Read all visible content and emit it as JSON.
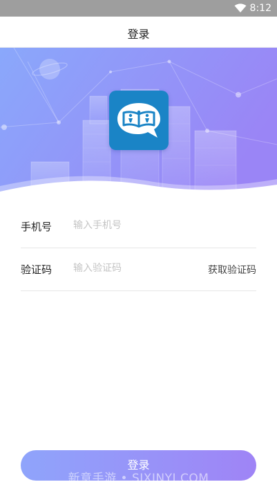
{
  "status_bar": {
    "time": "8:12",
    "wifi_icon": "wifi-icon"
  },
  "header": {
    "title": "登录"
  },
  "hero": {
    "logo_icon": "book-chat-logo",
    "gradient_colors": [
      "#8da6fb",
      "#9b86f7"
    ]
  },
  "form": {
    "phone": {
      "label": "手机号",
      "placeholder": "输入手机号",
      "value": ""
    },
    "code": {
      "label": "验证码",
      "placeholder": "输入验证码",
      "value": "",
      "get_code_label": "获取验证码"
    }
  },
  "login_button": {
    "label": "登录",
    "colors": [
      "#8fa4fb",
      "#9f84f6"
    ]
  },
  "watermark": "新意手游 • SJXINYI.COM"
}
